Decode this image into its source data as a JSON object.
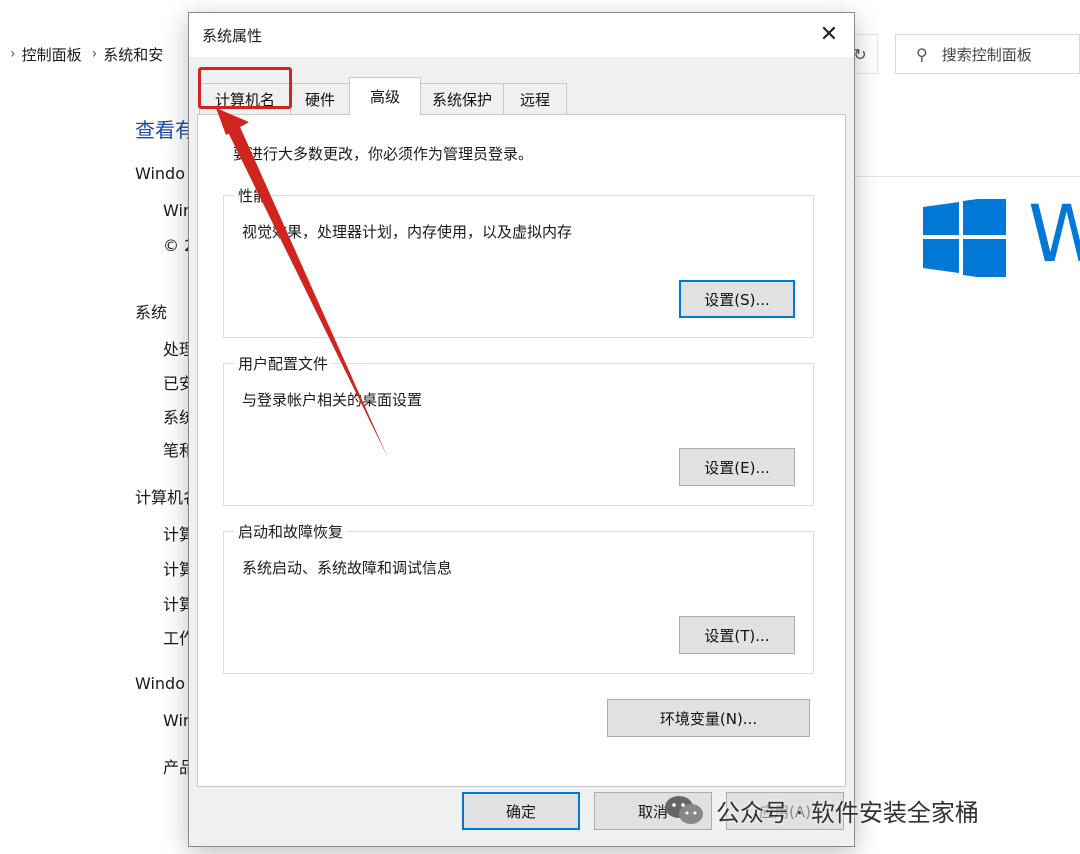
{
  "background": {
    "breadcrumb": [
      "控制面板",
      "系统和安"
    ],
    "search_placeholder": "搜索控制面板",
    "heading": "查看有",
    "lines": [
      {
        "text": "Windo",
        "indent": 0
      },
      {
        "text": "Wir",
        "indent": 1
      },
      {
        "text": "© 2",
        "indent": 1
      },
      {
        "text": "系统",
        "indent": 0
      },
      {
        "text": "处理",
        "indent": 1
      },
      {
        "text": "已安",
        "indent": 1
      },
      {
        "text": "系统",
        "indent": 1
      },
      {
        "text": "笔和",
        "indent": 1
      },
      {
        "text": "计算机名",
        "indent": 0
      },
      {
        "text": "计算",
        "indent": 1
      },
      {
        "text": "计算",
        "indent": 1
      },
      {
        "text": "计算",
        "indent": 1
      },
      {
        "text": "工作",
        "indent": 1
      },
      {
        "text": "Windo",
        "indent": 0
      },
      {
        "text": "Wir",
        "indent": 1
      },
      {
        "text": "产品",
        "indent": 1
      }
    ],
    "brand_letter": "W",
    "brand_color": "#0078d7"
  },
  "dialog": {
    "title": "系统属性",
    "tabs": [
      {
        "label": "计算机名",
        "active": false
      },
      {
        "label": "硬件",
        "active": false
      },
      {
        "label": "高级",
        "active": true
      },
      {
        "label": "系统保护",
        "active": false
      },
      {
        "label": "远程",
        "active": false
      }
    ],
    "notice": "要进行大多数更改，你必须作为管理员登录。",
    "groups": [
      {
        "title": "性能",
        "desc": "视觉效果，处理器计划，内存使用，以及虚拟内存",
        "button": "设置(S)..."
      },
      {
        "title": "用户配置文件",
        "desc": "与登录帐户相关的桌面设置",
        "button": "设置(E)..."
      },
      {
        "title": "启动和故障恢复",
        "desc": "系统启动、系统故障和调试信息",
        "button": "设置(T)..."
      }
    ],
    "env_button": "环境变量(N)...",
    "footer": {
      "ok": "确定",
      "cancel": "取消",
      "apply": "应用(A)"
    }
  },
  "annotation": {
    "color": "#d0251d"
  },
  "watermark": "公众号 · 软件安装全家桶"
}
